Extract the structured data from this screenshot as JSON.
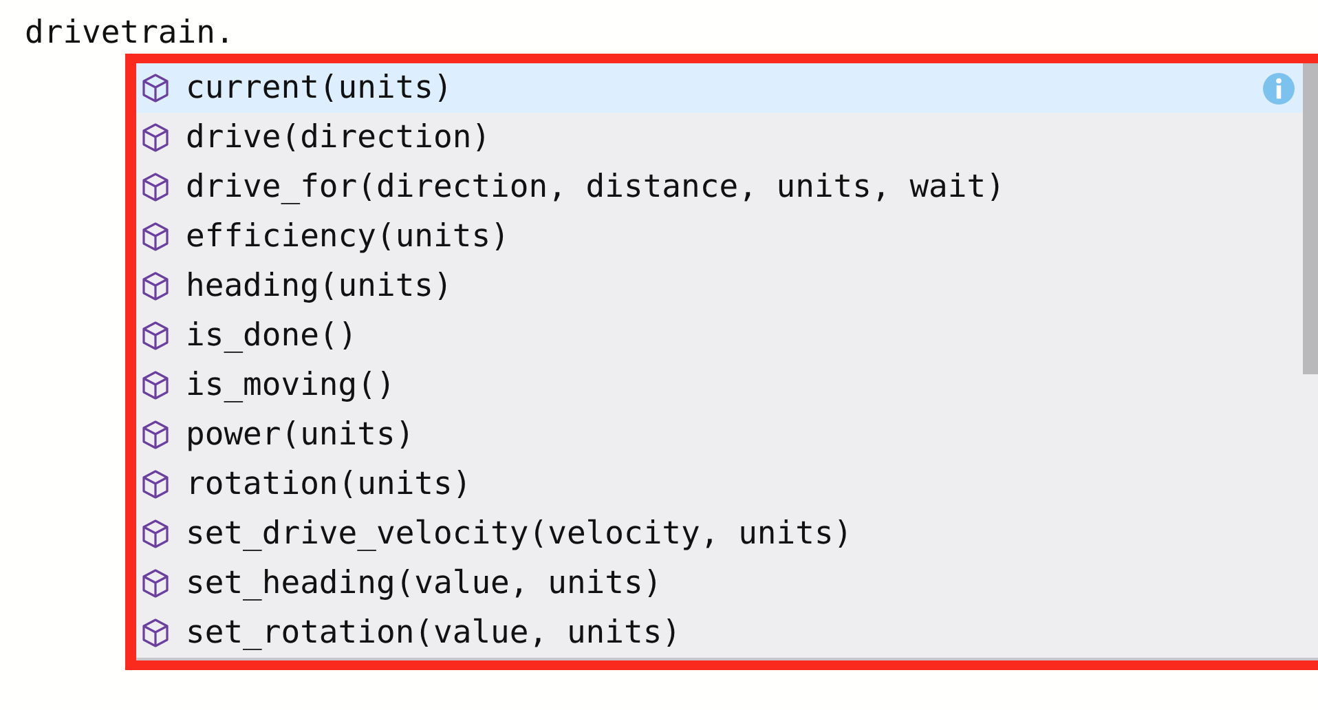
{
  "editor": {
    "code_line": "drivetrain."
  },
  "suggestions": [
    {
      "label": "current(units)",
      "selected": true
    },
    {
      "label": "drive(direction)",
      "selected": false
    },
    {
      "label": "drive_for(direction, distance, units, wait)",
      "selected": false
    },
    {
      "label": "efficiency(units)",
      "selected": false
    },
    {
      "label": "heading(units)",
      "selected": false
    },
    {
      "label": "is_done()",
      "selected": false
    },
    {
      "label": "is_moving()",
      "selected": false
    },
    {
      "label": "power(units)",
      "selected": false
    },
    {
      "label": "rotation(units)",
      "selected": false
    },
    {
      "label": "set_drive_velocity(velocity, units)",
      "selected": false
    },
    {
      "label": "set_heading(value, units)",
      "selected": false
    },
    {
      "label": "set_rotation(value, units)",
      "selected": false
    }
  ]
}
